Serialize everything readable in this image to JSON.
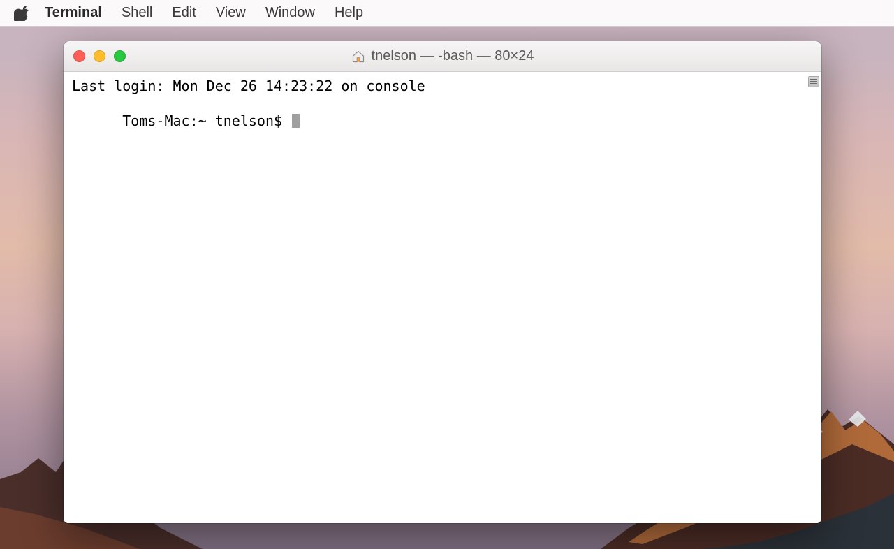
{
  "menubar": {
    "app": "Terminal",
    "items": [
      "Shell",
      "Edit",
      "View",
      "Window",
      "Help"
    ]
  },
  "window": {
    "title": "tnelson — -bash — 80×24"
  },
  "terminal": {
    "last_login": "Last login: Mon Dec 26 14:23:22 on console",
    "prompt": "Toms-Mac:~ tnelson$ "
  }
}
